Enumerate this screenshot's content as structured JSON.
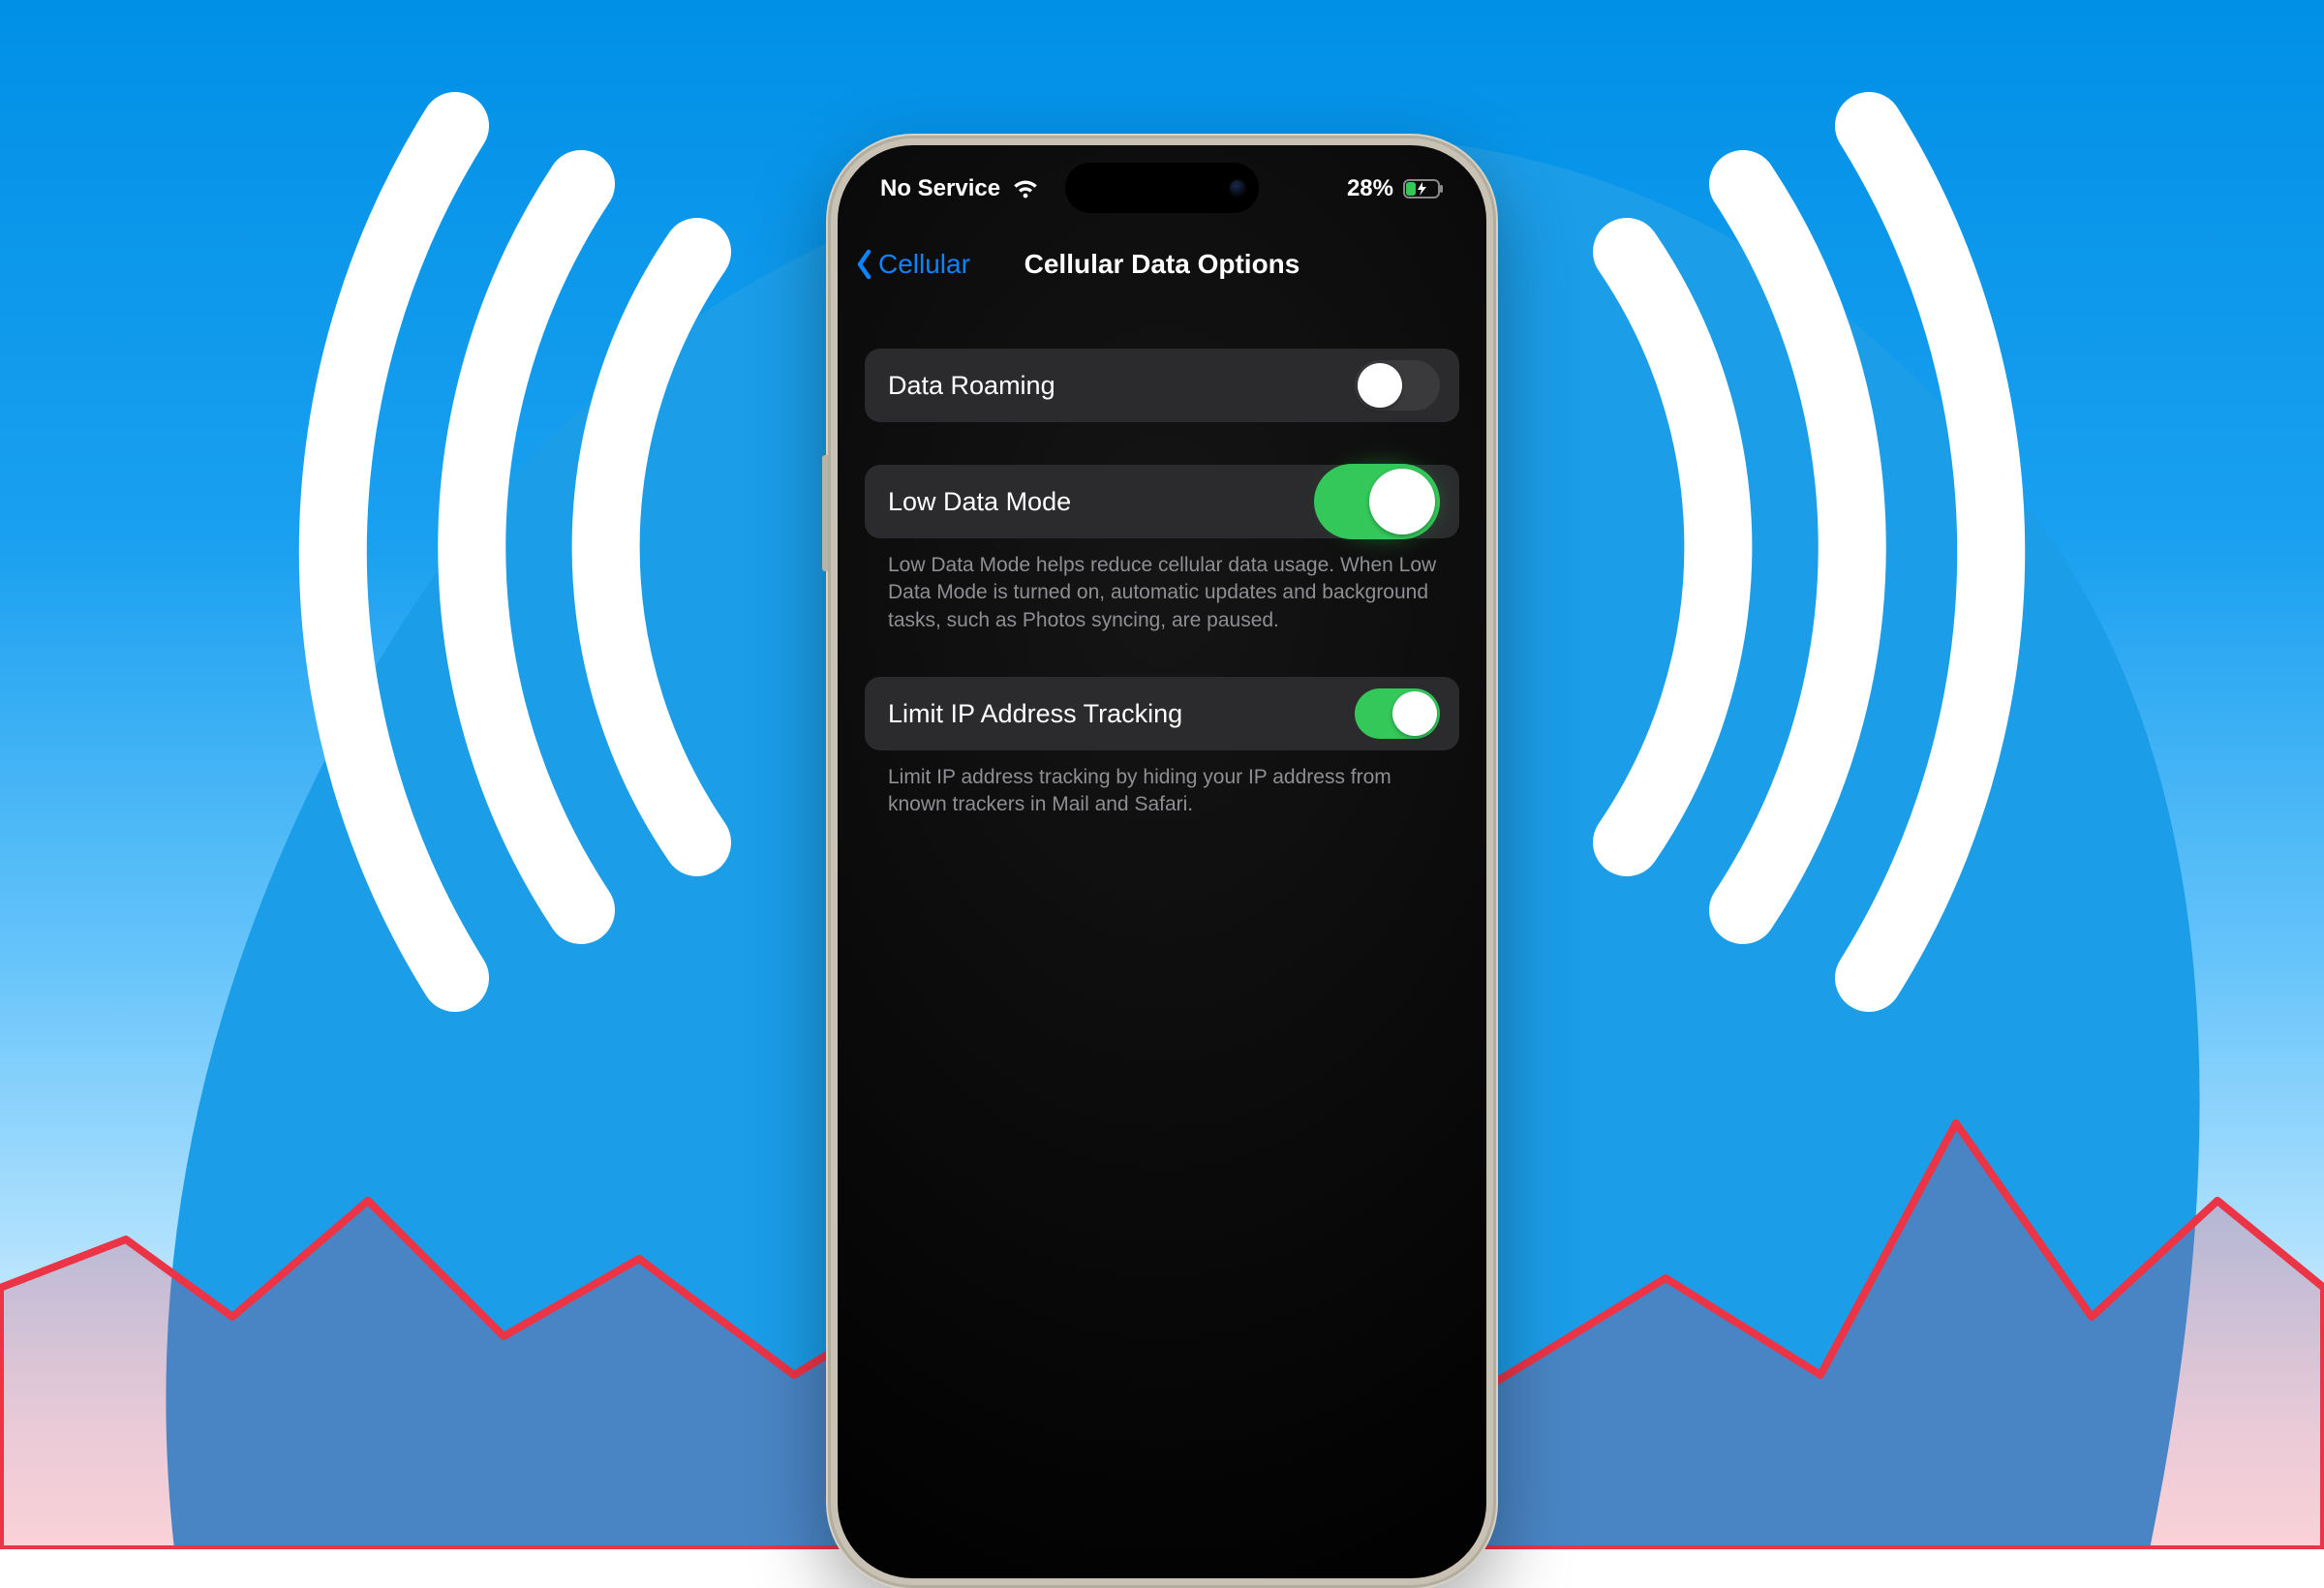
{
  "status": {
    "carrier_text": "No Service",
    "battery_pct": "28%"
  },
  "nav": {
    "back_label": "Cellular",
    "title": "Cellular Data Options"
  },
  "rows": {
    "data_roaming": {
      "label": "Data Roaming",
      "on": false
    },
    "low_data_mode": {
      "label": "Low Data Mode",
      "on": true,
      "footer": "Low Data Mode helps reduce cellular data usage. When Low Data Mode is turned on, automatic updates and background tasks, such as Photos syncing, are paused."
    },
    "limit_ip": {
      "label": "Limit IP Address Tracking",
      "on": true,
      "footer": "Limit IP address tracking by hiding your IP address from known trackers in Mail and Safari."
    }
  },
  "colors": {
    "ios_blue": "#0a84ff",
    "ios_green": "#34c759",
    "switch_off_bg": "#3a3a3c"
  }
}
